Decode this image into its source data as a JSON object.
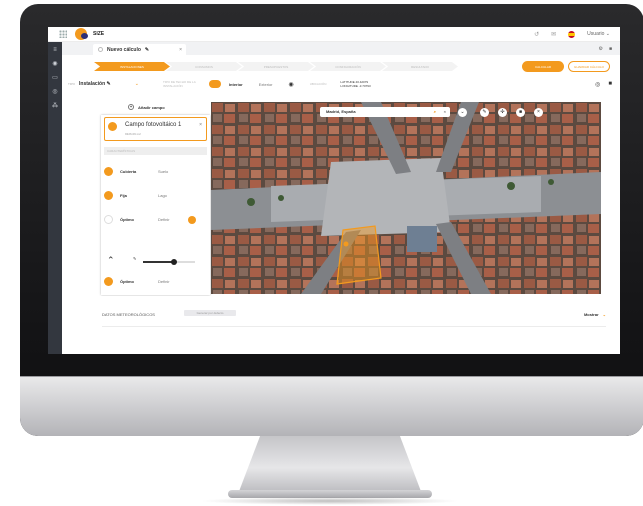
{
  "app": {
    "brand": "SIZE",
    "user": "Usuario"
  },
  "tab": {
    "label": "Nuevo cálculo"
  },
  "steps": [
    "INSTALACIONES",
    "CONSUMOS",
    "PRESUPUESTOS",
    "CONFIGURACIÓN",
    "RESULTADO"
  ],
  "buttons": {
    "calc": "CALCULAR",
    "save": "GUARDAR CÁLCULO"
  },
  "options": {
    "type_label": "TIPO",
    "type_value": "Instalación",
    "roof_label": "TIPO DE TECHO DE LA INSTALACIÓN",
    "interior": "Interior",
    "exterior": "Exterior",
    "location_label": "UBICACIÓN",
    "lat_label": "LATITUDE",
    "lon_label": "LONGITUDE",
    "lat_value": "40.42079",
    "lon_value": "-3.70793"
  },
  "panel": {
    "add_field": "Añadir campo",
    "field_title": "Campo fotovoltáico 1",
    "field_sub": "9326.09 m2",
    "characteristics": "CARACTERÍSTICAS",
    "rows": [
      {
        "a": "Cubierta",
        "b": "Suelo"
      },
      {
        "a": "Fija",
        "b": "Lago"
      },
      {
        "a": "Óptimo",
        "b": "Definir"
      },
      {
        "a": "Óptimo",
        "b": "Definir"
      }
    ]
  },
  "map": {
    "search": "Madrid, España"
  },
  "bottom": {
    "meteo": "DATOS METEOROLÓGICOS",
    "meteo_btn": "Generar por defecto",
    "show": "Mostrar"
  }
}
